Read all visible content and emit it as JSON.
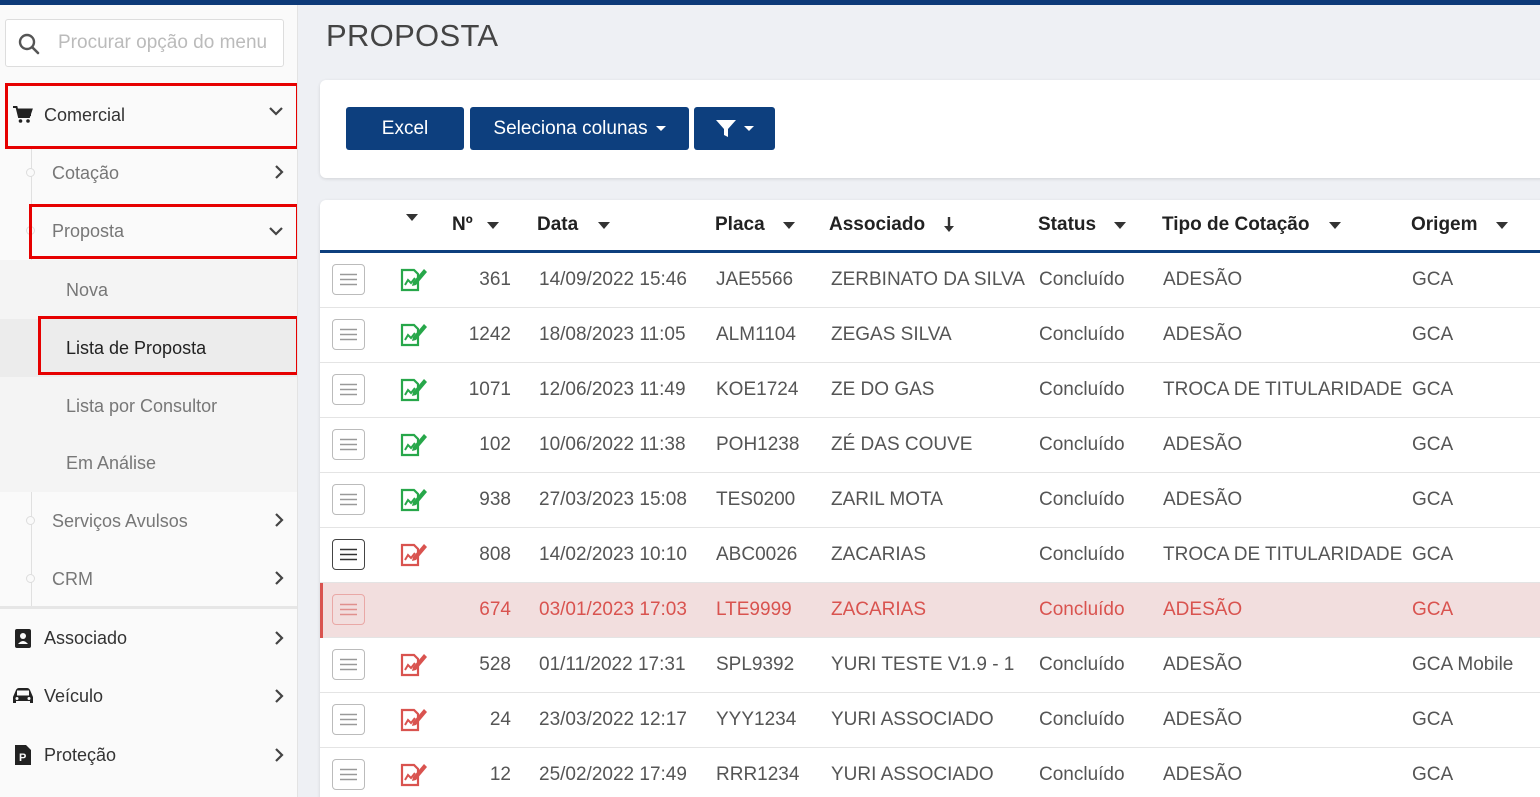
{
  "sidebar": {
    "search_placeholder": "Procurar opção do menu",
    "comercial": "Comercial",
    "cotacao": "Cotação",
    "proposta": "Proposta",
    "nova": "Nova",
    "lista_proposta": "Lista de Proposta",
    "lista_consultor": "Lista por Consultor",
    "em_analise": "Em Análise",
    "servicos_avulsos": "Serviços Avulsos",
    "crm": "CRM",
    "associado": "Associado",
    "veiculo": "Veículo",
    "protecao": "Proteção"
  },
  "page": {
    "title": "PROPOSTA"
  },
  "toolbar": {
    "excel": "Excel",
    "columns": "Seleciona colunas"
  },
  "table": {
    "headers": {
      "num": "Nº",
      "data": "Data",
      "placa": "Placa",
      "associado": "Associado",
      "status": "Status",
      "tipo": "Tipo de Cotação",
      "origem": "Origem"
    },
    "rows": [
      {
        "num": "361",
        "data": "14/09/2022 15:46",
        "placa": "JAE5566",
        "associado": "ZERBINATO DA SILVA",
        "status": "Concluído",
        "tipo": "ADESÃO",
        "origem": "GCA",
        "icon": "green"
      },
      {
        "num": "1242",
        "data": "18/08/2023 11:05",
        "placa": "ALM1104",
        "associado": "ZEGAS SILVA",
        "status": "Concluído",
        "tipo": "ADESÃO",
        "origem": "GCA",
        "icon": "green"
      },
      {
        "num": "1071",
        "data": "12/06/2023 11:49",
        "placa": "KOE1724",
        "associado": "ZE DO GAS",
        "status": "Concluído",
        "tipo": "TROCA DE TITULARIDADE",
        "origem": "GCA",
        "icon": "green"
      },
      {
        "num": "102",
        "data": "10/06/2022 11:38",
        "placa": "POH1238",
        "associado": "ZÉ DAS COUVE",
        "status": "Concluído",
        "tipo": "ADESÃO",
        "origem": "GCA",
        "icon": "green"
      },
      {
        "num": "938",
        "data": "27/03/2023 15:08",
        "placa": "TES0200",
        "associado": "ZARIL MOTA",
        "status": "Concluído",
        "tipo": "ADESÃO",
        "origem": "GCA",
        "icon": "green"
      },
      {
        "num": "808",
        "data": "14/02/2023 10:10",
        "placa": "ABC0026",
        "associado": "ZACARIAS",
        "status": "Concluído",
        "tipo": "TROCA DE TITULARIDADE",
        "origem": "GCA",
        "icon": "red"
      },
      {
        "num": "674",
        "data": "03/01/2023 17:03",
        "placa": "LTE9999",
        "associado": "ZACARIAS",
        "status": "Concluído",
        "tipo": "ADESÃO",
        "origem": "GCA",
        "icon": "none"
      },
      {
        "num": "528",
        "data": "01/11/2022 17:31",
        "placa": "SPL9392",
        "associado": "YURI TESTE V1.9 - 1",
        "status": "Concluído",
        "tipo": "ADESÃO",
        "origem": "GCA Mobile",
        "icon": "red"
      },
      {
        "num": "24",
        "data": "23/03/2022 12:17",
        "placa": "YYY1234",
        "associado": "YURI ASSOCIADO",
        "status": "Concluído",
        "tipo": "ADESÃO",
        "origem": "GCA",
        "icon": "red"
      },
      {
        "num": "12",
        "data": "25/02/2022 17:49",
        "placa": "RRR1234",
        "associado": "YURI ASSOCIADO",
        "status": "Concluído",
        "tipo": "ADESÃO",
        "origem": "GCA",
        "icon": "red"
      }
    ]
  }
}
